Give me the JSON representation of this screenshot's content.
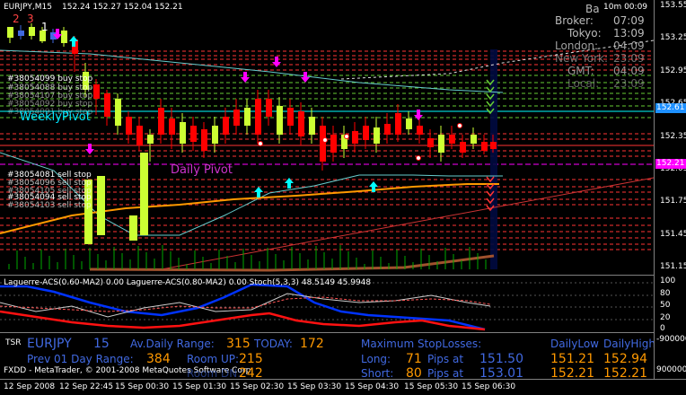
{
  "window": {
    "symbol_title": "EURJPY,M15",
    "ohlc": "152.24 152.27 152.04 152.21"
  },
  "colors": {
    "bull": "#ccff33",
    "bear": "#ff0000",
    "bull_alt": "#4169e1",
    "bear_alt": "#6495ed",
    "grid_red": "#ff3333",
    "grid_green": "#66cc33",
    "sell_line": "#ff0000",
    "pivot_weekly": "#00ffff",
    "pivot_daily": "#cc33cc",
    "ma_orange": "#ff9900",
    "ma_brown": "#a0522d",
    "bands": "#66cccc"
  },
  "chart_labels": {
    "corner_digits": [
      "2",
      "3",
      "1"
    ],
    "buy_stop_header": "#38054099 buy stop",
    "buy_stops": [
      "#38054088 buy stop",
      "#38054107 buy stop",
      "#38054092 buy stop",
      "#38054091 buy stop"
    ],
    "sell_stop_header": "#38054081 sell stop",
    "sell_stops": [
      "#38054096 sell stop",
      "#38054105 sell stop",
      "#38054094 sell stop",
      "#38054103 sell stop"
    ],
    "weekly_pivot": "WeeklyPivot",
    "daily_pivot": "Daily Pivot"
  },
  "clock_panel": {
    "rows": [
      {
        "label": "Broker:",
        "value": "07:09",
        "opacity": 1
      },
      {
        "label": "Tokyo:",
        "value": "13:09",
        "opacity": 1
      },
      {
        "label": "London:",
        "value": "04:09",
        "opacity": 0.85
      },
      {
        "label": "New York:",
        "value": "23:09",
        "opacity": 0.6
      },
      {
        "label": "GMT:",
        "value": "04:09",
        "opacity": 0.8
      },
      {
        "label": "Local:",
        "value": "23:09",
        "opacity": 0.5
      }
    ],
    "top_label": "Ba",
    "top_value": "10m 00:09"
  },
  "price_axis": {
    "ticks": [
      "153.55",
      "153.25",
      "152.95",
      "152.65",
      "152.35",
      "152.05",
      "151.75",
      "151.45",
      "151.15"
    ],
    "badge_blue": "152.61",
    "badge_magenta": "152.21",
    "sub_ticks": [
      "100",
      "80",
      "50",
      "20",
      "0"
    ],
    "tsr_ticks": [
      "-9000000",
      "9000000"
    ]
  },
  "indicator": {
    "title": "Laguerre-ACS(0.60-MA2) 0.00  Laguerre-ACS(0.80-MA2) 0.00  Stoch(5,3,3) 48.5149 45.9948"
  },
  "tsr_panel": {
    "tag": "TSR",
    "pair": "EURJPY",
    "timeframe": "15",
    "avg_label": "Av.Daily Range:",
    "avg_value": "315",
    "today_label": "TODAY:",
    "today_value": "172",
    "prev_label": "Prev 01 Day Range:",
    "prev_value": "384",
    "room_up_label": "Room UP:",
    "room_up_value": "215",
    "room_down_label": "Room DN:",
    "room_down_value": "242",
    "fxdd_text": "FXDD - MetaTrader, © 2001-2008 MetaQuotes Software Corp.",
    "max_sl_label": "Maximum StopLosses:",
    "long_label": "Long:",
    "long_pips": "71",
    "pips_at": "Pips at",
    "long_price": "151.50",
    "short_label": "Short:",
    "short_pips": "80",
    "short_price": "153.01",
    "daily_low_header": "DailyLow",
    "daily_high_header": "DailyHigh",
    "low_row1": "151.21",
    "high_row1": "152.94",
    "low_row2": "152.21",
    "high_row2": "152.21"
  },
  "time_axis": {
    "labels": [
      "12 Sep 2008",
      "12 Sep 22:45",
      "15 Sep 00:30",
      "15 Sep 01:30",
      "15 Sep 02:30",
      "15 Sep 03:30",
      "15 Sep 04:30",
      "15 Sep 05:30",
      "15 Sep 06:30"
    ]
  }
}
